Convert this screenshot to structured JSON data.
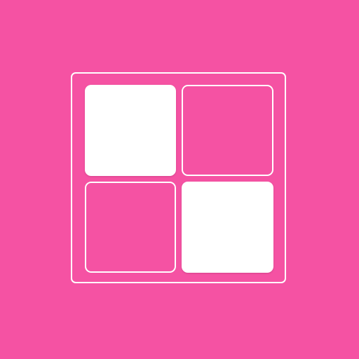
{
  "icon": {
    "name": "grid-2x2-icon",
    "background_color": "#f552a3",
    "foreground_color": "#ffffff"
  },
  "grid": {
    "rows": 2,
    "columns": 2,
    "cells": [
      {
        "position": "top-left",
        "state": "filled"
      },
      {
        "position": "top-right",
        "state": "outlined"
      },
      {
        "position": "bottom-left",
        "state": "outlined"
      },
      {
        "position": "bottom-right",
        "state": "filled"
      }
    ]
  }
}
